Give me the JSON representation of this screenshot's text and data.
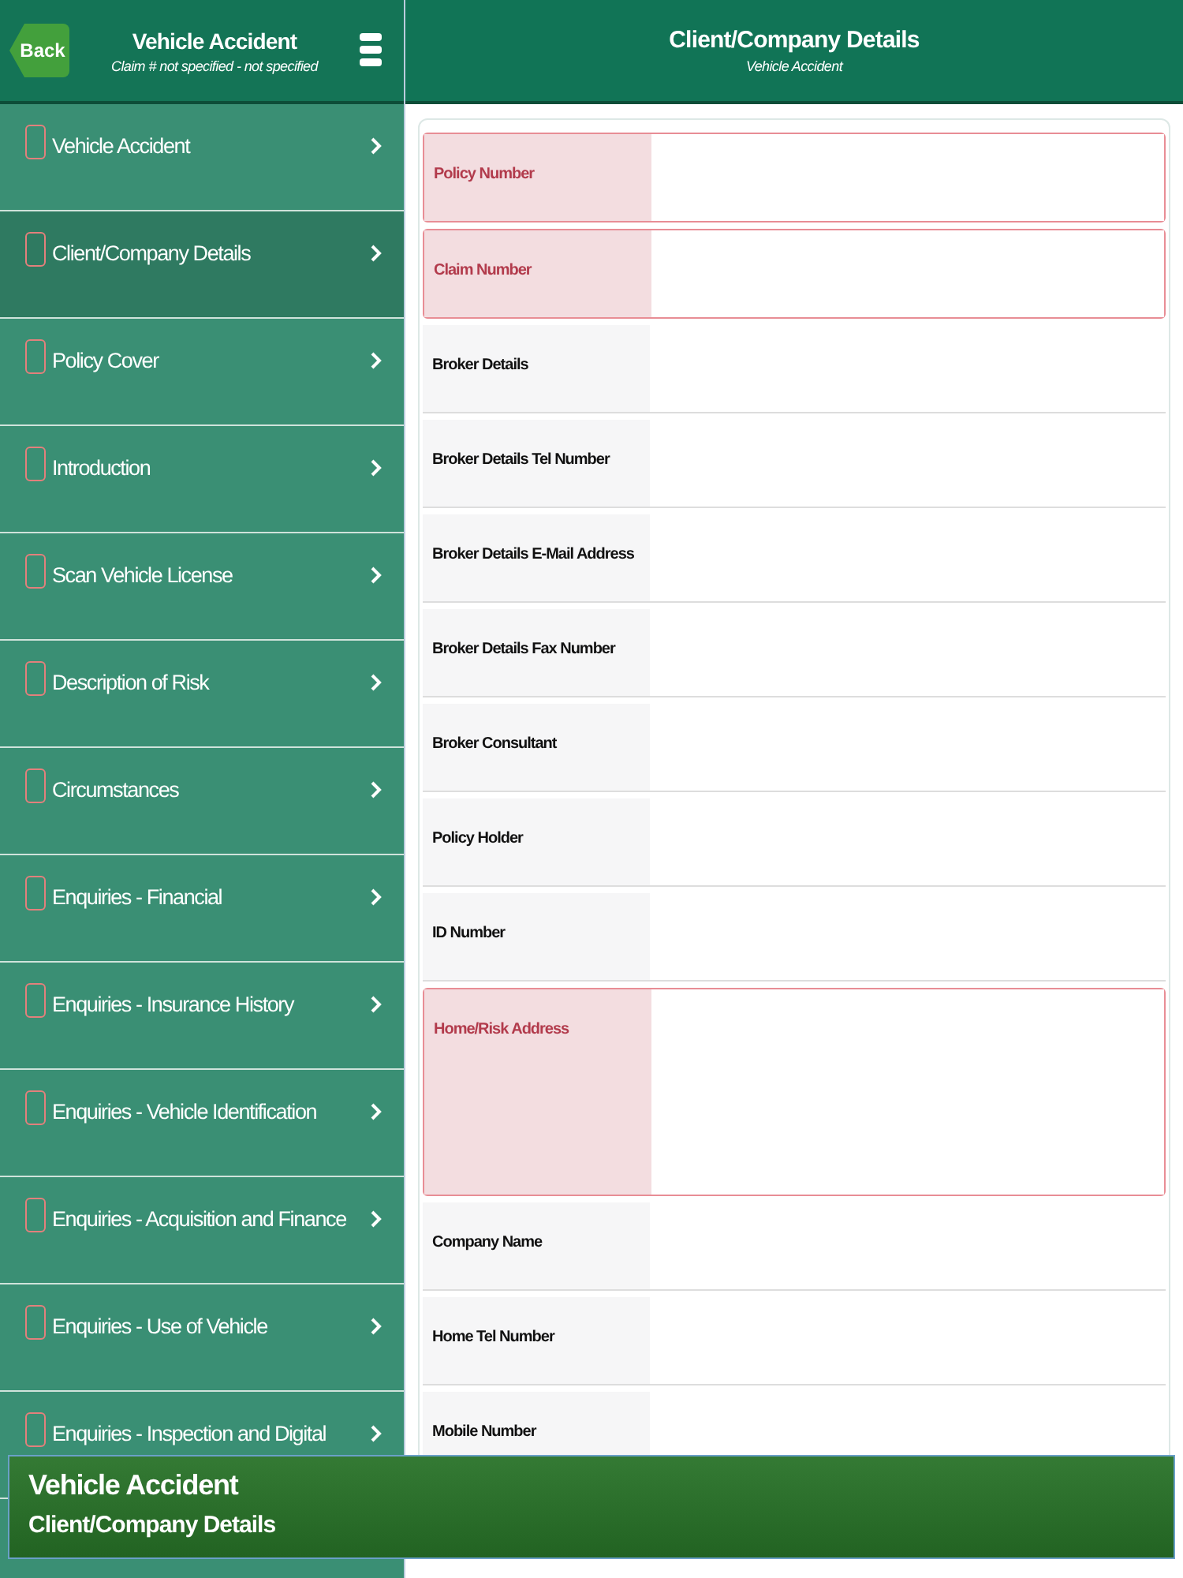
{
  "sidebar_header": {
    "back_button": "Back",
    "title": "Vehicle Accident",
    "subtitle": "Claim # not specified - not specified"
  },
  "sidebar": {
    "items": [
      {
        "label": "Vehicle Accident",
        "selected": false,
        "checked": false
      },
      {
        "label": "Client/Company Details",
        "selected": true,
        "checked": false
      },
      {
        "label": "Policy Cover",
        "selected": false,
        "checked": false
      },
      {
        "label": "Introduction",
        "selected": false,
        "checked": false
      },
      {
        "label": "Scan Vehicle License",
        "selected": false,
        "checked": false
      },
      {
        "label": "Description of Risk",
        "selected": false,
        "checked": false
      },
      {
        "label": "Circumstances",
        "selected": false,
        "checked": false
      },
      {
        "label": "Enquiries - Financial",
        "selected": false,
        "checked": false
      },
      {
        "label": "Enquiries - Insurance History",
        "selected": false,
        "checked": false
      },
      {
        "label": "Enquiries - Vehicle Identification",
        "selected": false,
        "checked": false
      },
      {
        "label": "Enquiries - Acquisition and Finance",
        "selected": false,
        "checked": false
      },
      {
        "label": "Enquiries - Use of Vehicle",
        "selected": false,
        "checked": false
      },
      {
        "label": "Enquiries - Inspection and Digital",
        "selected": false,
        "checked": false
      }
    ]
  },
  "content_header": {
    "title": "Client/Company Details",
    "subtitle": "Vehicle Accident"
  },
  "form": {
    "fields": [
      {
        "label": "Policy Number",
        "required": true,
        "kind": "line"
      },
      {
        "label": "Claim Number",
        "required": true,
        "kind": "line"
      },
      {
        "label": "Broker Details",
        "required": false,
        "kind": "line"
      },
      {
        "label": "Broker Details Tel Number",
        "required": false,
        "kind": "line"
      },
      {
        "label": "Broker Details E-Mail Address",
        "required": false,
        "kind": "line"
      },
      {
        "label": "Broker Details Fax Number",
        "required": false,
        "kind": "line"
      },
      {
        "label": "Broker Consultant",
        "required": false,
        "kind": "line"
      },
      {
        "label": "Policy Holder",
        "required": false,
        "kind": "line"
      },
      {
        "label": "ID Number",
        "required": false,
        "kind": "line"
      },
      {
        "label": "Home/Risk Address",
        "required": true,
        "kind": "area"
      },
      {
        "label": "Company Name",
        "required": false,
        "kind": "line"
      },
      {
        "label": "Home Tel Number",
        "required": false,
        "kind": "line"
      },
      {
        "label": "Mobile Number",
        "required": false,
        "kind": "line"
      }
    ]
  },
  "toast": {
    "title": "Vehicle Accident",
    "subtitle": "Client/Company Details"
  }
}
